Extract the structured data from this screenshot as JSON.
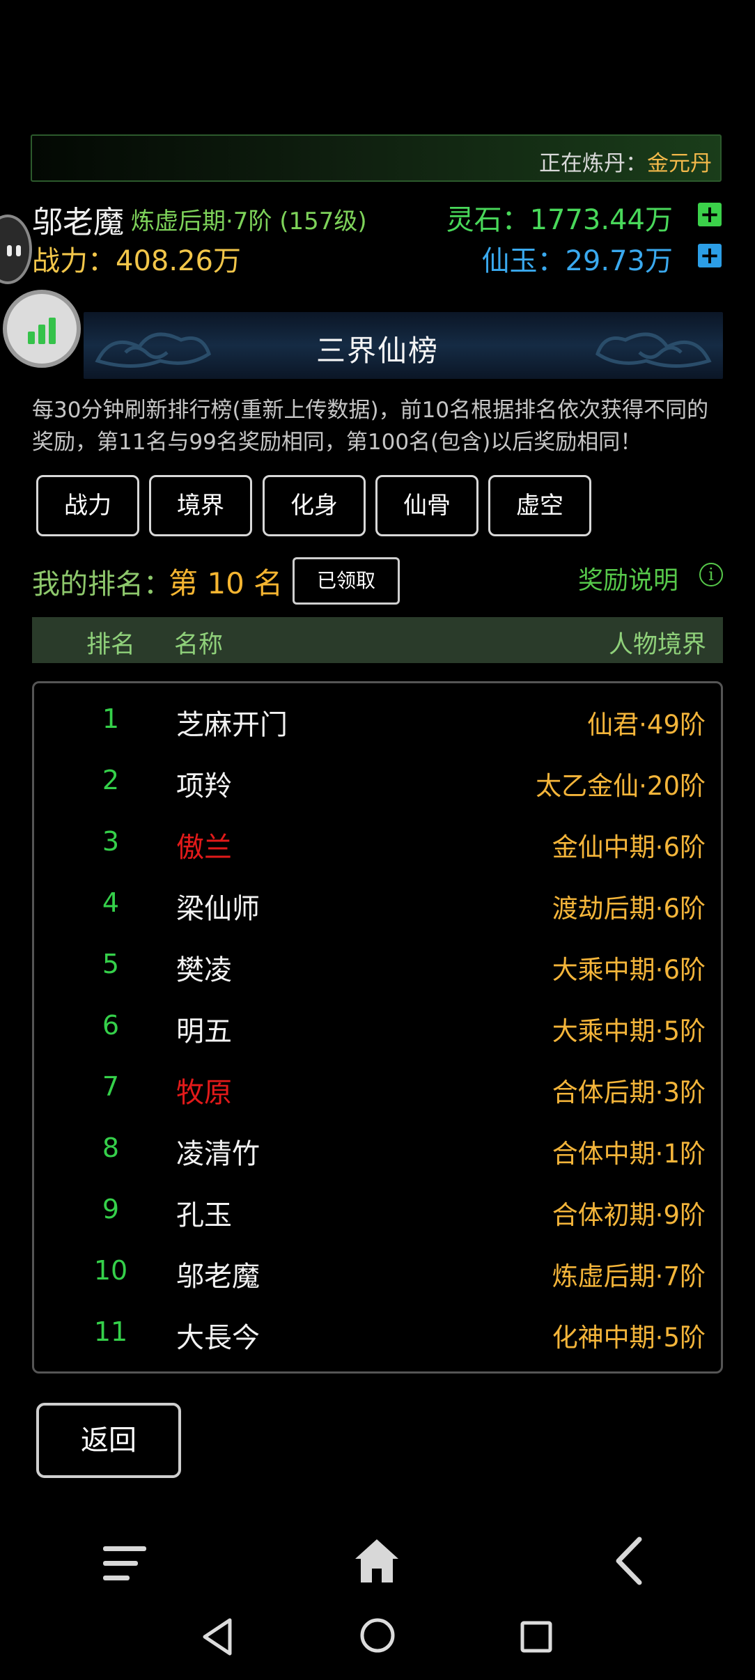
{
  "alchemy": {
    "label": "正在炼丹：",
    "value": "金元丹"
  },
  "player": {
    "name": "邬老魔",
    "realm": "炼虚后期·7阶 (157级)",
    "power": "战力：408.26万",
    "lingshi": "灵石：1773.44万",
    "xianyu": "仙玉：29.73万"
  },
  "banner": {
    "title": "三界仙榜"
  },
  "rules": "每30分钟刷新排行榜(重新上传数据)，前10名根据排名依次获得不同的奖励，第11名与99名奖励相同，第100名(包含)以后奖励相同！",
  "tabs": [
    "战力",
    "境界",
    "化身",
    "仙骨",
    "虚空"
  ],
  "my_rank": {
    "label": "我的排名：",
    "value": "第 10 名",
    "claimed_button": "已领取",
    "reward_info": "奖励说明",
    "info_icon": "i"
  },
  "table": {
    "headers": {
      "rank": "排名",
      "name": "名称",
      "realm": "人物境界"
    },
    "rows": [
      {
        "rank": "1",
        "name": "芝麻开门",
        "realm": "仙君·49阶",
        "name_color": "#f2f2f2"
      },
      {
        "rank": "2",
        "name": "项羚",
        "realm": "太乙金仙·20阶",
        "name_color": "#f2f2f2"
      },
      {
        "rank": "3",
        "name": "傲兰",
        "realm": "金仙中期·6阶",
        "name_color": "#e21a1a"
      },
      {
        "rank": "4",
        "name": "梁仙师",
        "realm": "渡劫后期·6阶",
        "name_color": "#f2f2f2"
      },
      {
        "rank": "5",
        "name": "樊凌",
        "realm": "大乘中期·6阶",
        "name_color": "#f2f2f2"
      },
      {
        "rank": "6",
        "name": "明五",
        "realm": "大乘中期·5阶",
        "name_color": "#f2f2f2"
      },
      {
        "rank": "7",
        "name": "牧原",
        "realm": "合体后期·3阶",
        "name_color": "#e21a1a"
      },
      {
        "rank": "8",
        "name": "凌清竹",
        "realm": "合体中期·1阶",
        "name_color": "#f2f2f2"
      },
      {
        "rank": "9",
        "name": "孔玉",
        "realm": "合体初期·9阶",
        "name_color": "#f2f2f2"
      },
      {
        "rank": "10",
        "name": "邬老魔",
        "realm": "炼虚后期·7阶",
        "name_color": "#f2f2f2"
      },
      {
        "rank": "11",
        "name": "大長今",
        "realm": "化神中期·5阶",
        "name_color": "#f2f2f2"
      }
    ]
  },
  "back_button": "返回",
  "icons": {
    "plus": "+",
    "nav": [
      "menu-icon",
      "home-icon",
      "chevron-left-icon"
    ],
    "system": [
      "system-back-icon",
      "system-home-icon",
      "system-recent-icon"
    ]
  },
  "colors": {
    "gold": "#f2b84a",
    "green": "#35d04a",
    "blue": "#3aa9ee",
    "red": "#e21a1a"
  }
}
